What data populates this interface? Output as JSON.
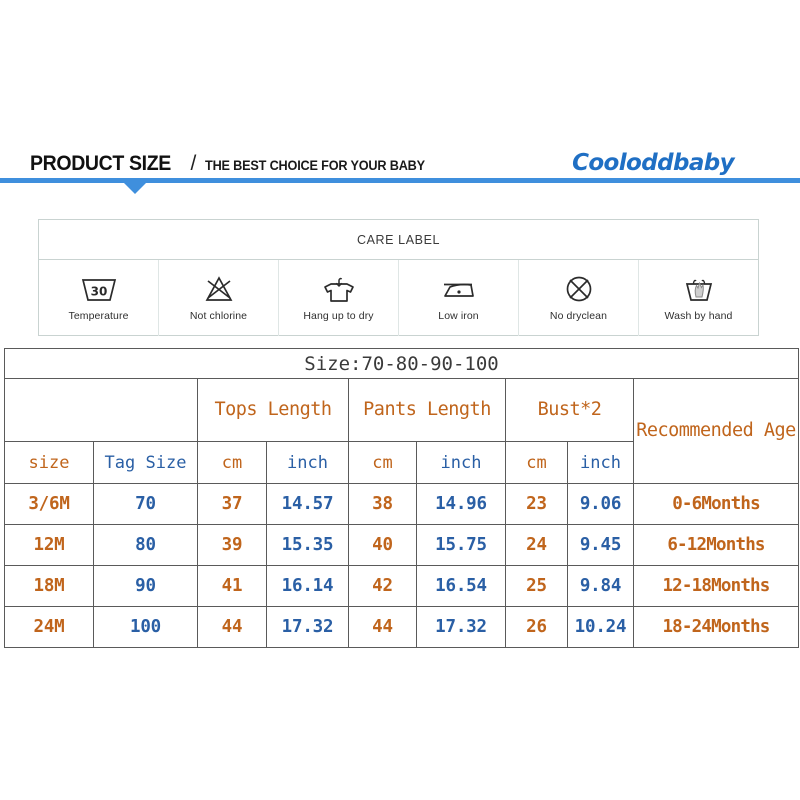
{
  "header": {
    "title_main": "PRODUCT SIZE",
    "separator": "/",
    "title_sub": "THE BEST CHOICE FOR YOUR BABY",
    "brand": "Cooloddbaby",
    "accent_color": "#3f8fdd",
    "brand_color": "#1f6fc4"
  },
  "care_label": {
    "heading": "CARE LABEL",
    "items": [
      {
        "icon": "wash-temperature-30-icon",
        "label": "Temperature"
      },
      {
        "icon": "do-not-bleach-icon",
        "label": "Not chlorine"
      },
      {
        "icon": "hang-dry-icon",
        "label": "Hang up to dry"
      },
      {
        "icon": "low-iron-icon",
        "label": "Low iron"
      },
      {
        "icon": "no-dryclean-icon",
        "label": "No dryclean"
      },
      {
        "icon": "hand-wash-icon",
        "label": "Wash by hand"
      }
    ]
  },
  "size_table": {
    "title": "Size:70-80-90-100",
    "group_headers": {
      "blank": "",
      "tops_length": "Tops Length",
      "pants_length": "Pants Length",
      "bust": "Bust*2",
      "recommended_age": "Recommended Age"
    },
    "unit_headers": {
      "size": "size",
      "tag_size": "Tag Size",
      "tops_cm": "cm",
      "tops_inch": "inch",
      "pants_cm": "cm",
      "pants_inch": "inch",
      "bust_cm": "cm",
      "bust_inch": "inch",
      "age_blank": ""
    },
    "colors": {
      "orange": "#c0651c",
      "blue": "#2a5fa5",
      "title": "#3a3a3a",
      "border": "#5a5a5a"
    },
    "rows": [
      {
        "size": "3/6M",
        "tag_size": "70",
        "tops_cm": "37",
        "tops_inch": "14.57",
        "pants_cm": "38",
        "pants_inch": "14.96",
        "bust_cm": "23",
        "bust_inch": "9.06",
        "age": "0-6Months"
      },
      {
        "size": "12M",
        "tag_size": "80",
        "tops_cm": "39",
        "tops_inch": "15.35",
        "pants_cm": "40",
        "pants_inch": "15.75",
        "bust_cm": "24",
        "bust_inch": "9.45",
        "age": "6-12Months"
      },
      {
        "size": "18M",
        "tag_size": "90",
        "tops_cm": "41",
        "tops_inch": "16.14",
        "pants_cm": "42",
        "pants_inch": "16.54",
        "bust_cm": "25",
        "bust_inch": "9.84",
        "age": "12-18Months"
      },
      {
        "size": "24M",
        "tag_size": "100",
        "tops_cm": "44",
        "tops_inch": "17.32",
        "pants_cm": "44",
        "pants_inch": "17.32",
        "bust_cm": "26",
        "bust_inch": "10.24",
        "age": "18-24Months"
      }
    ]
  }
}
